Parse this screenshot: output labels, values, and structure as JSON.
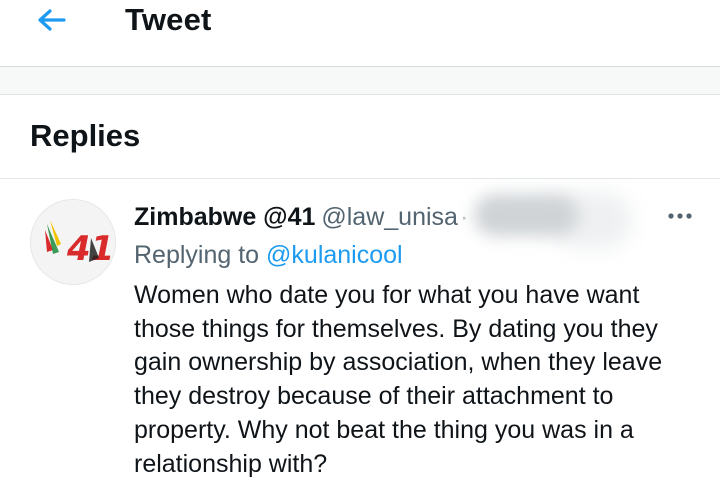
{
  "header": {
    "title": "Tweet",
    "back_icon": "arrow-left-icon"
  },
  "replies_section": {
    "title": "Replies"
  },
  "reply": {
    "display_name": "Zimbabwe @41",
    "handle": "@law_unisa",
    "separator": "·",
    "replying_prefix": "Replying to",
    "replying_to": "@kulanicool",
    "avatar_text": "41",
    "text_lines": [
      "Women who date you for what you have want",
      "those things for themselves. By dating you they",
      "gain ownership by association, when they leave",
      "they destroy because of their attachment to",
      "property. Why not beat the thing you was in a",
      "relationship with?"
    ]
  },
  "colors": {
    "accent": "#1d9bf0",
    "text_primary": "#0f1419",
    "text_secondary": "#536471",
    "avatar_red": "#d92b2b",
    "avatar_green": "#1a8a3a",
    "avatar_yellow": "#f2c200"
  }
}
